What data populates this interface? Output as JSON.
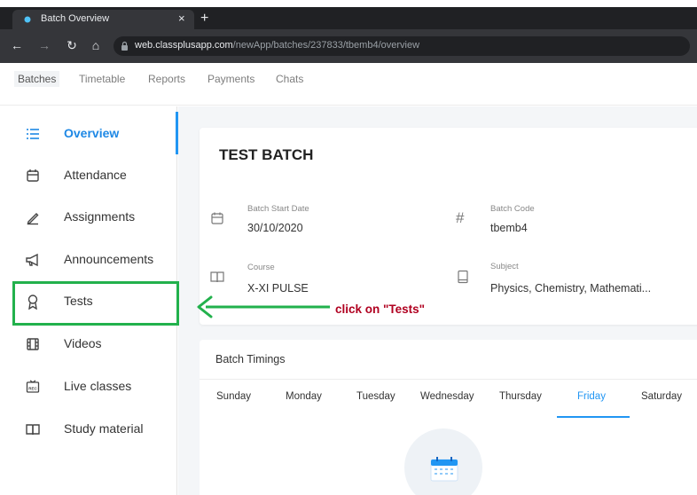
{
  "browser": {
    "tab_title": "Batch Overview",
    "tab_close": "×",
    "new_tab": "+",
    "url_domain": "web.classplusapp.com",
    "url_path": "/newApp/batches/237833/tbemb4/overview"
  },
  "app_nav": {
    "items": [
      "Batches",
      "Timetable",
      "Reports",
      "Payments",
      "Chats"
    ]
  },
  "sidebar": {
    "items": [
      {
        "label": "Overview",
        "icon": "list-icon"
      },
      {
        "label": "Attendance",
        "icon": "calendar-icon"
      },
      {
        "label": "Assignments",
        "icon": "pen-icon"
      },
      {
        "label": "Announcements",
        "icon": "megaphone-icon"
      },
      {
        "label": "Tests",
        "icon": "award-icon"
      },
      {
        "label": "Videos",
        "icon": "film-icon"
      },
      {
        "label": "Live classes",
        "icon": "rec-icon"
      },
      {
        "label": "Study material",
        "icon": "book-icon"
      }
    ],
    "active_color": "#1e88e5"
  },
  "annotation": {
    "text": "click on \"Tests\"",
    "arrow_color": "#22b14c",
    "text_color": "#b00020"
  },
  "batch": {
    "title": "TEST BATCH",
    "start_date_label": "Batch Start Date",
    "start_date": "30/10/2020",
    "code_label": "Batch Code",
    "code": "tbemb4",
    "course_label": "Course",
    "course": "X-XI PULSE",
    "subject_label": "Subject",
    "subject": "Physics, Chemistry, Mathemati..."
  },
  "timings": {
    "title": "Batch Timings",
    "days": [
      "Sunday",
      "Monday",
      "Tuesday",
      "Wednesday",
      "Thursday",
      "Friday",
      "Saturday"
    ],
    "selected_day": "Friday"
  }
}
